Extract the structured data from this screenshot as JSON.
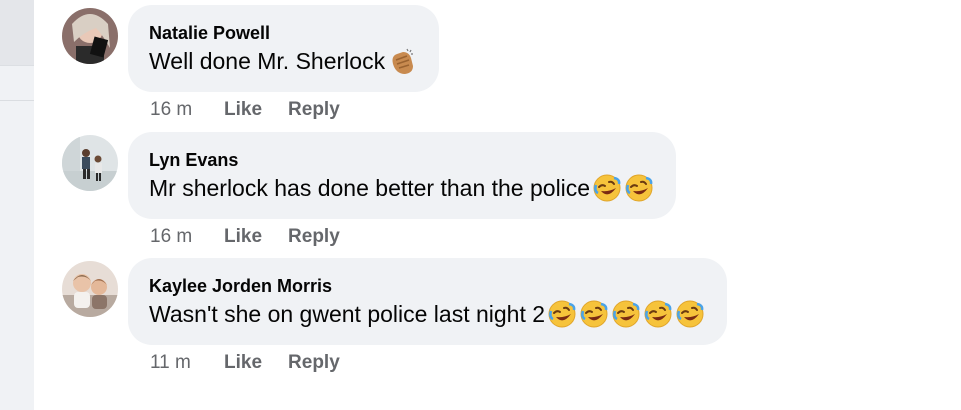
{
  "comments": [
    {
      "author": "Natalie Powell",
      "text": "Well done Mr. Sherlock",
      "emojis": [
        "clapping-hands"
      ],
      "time": "16 m",
      "like": "Like",
      "reply": "Reply"
    },
    {
      "author": "Lyn Evans",
      "text": "Mr sherlock has done better than the police",
      "emojis": [
        "rolling-laughing",
        "rolling-laughing"
      ],
      "time": "16 m",
      "like": "Like",
      "reply": "Reply"
    },
    {
      "author": "Kaylee Jorden Morris",
      "text": "Wasn't she on gwent police last night 2",
      "emojis": [
        "rolling-laughing",
        "rolling-laughing",
        "rolling-laughing",
        "rolling-laughing",
        "rolling-laughing"
      ],
      "time": "11 m",
      "like": "Like",
      "reply": "Reply"
    }
  ],
  "colors": {
    "bubble": "#f0f2f5",
    "text": "#050505",
    "meta": "#65676b"
  }
}
